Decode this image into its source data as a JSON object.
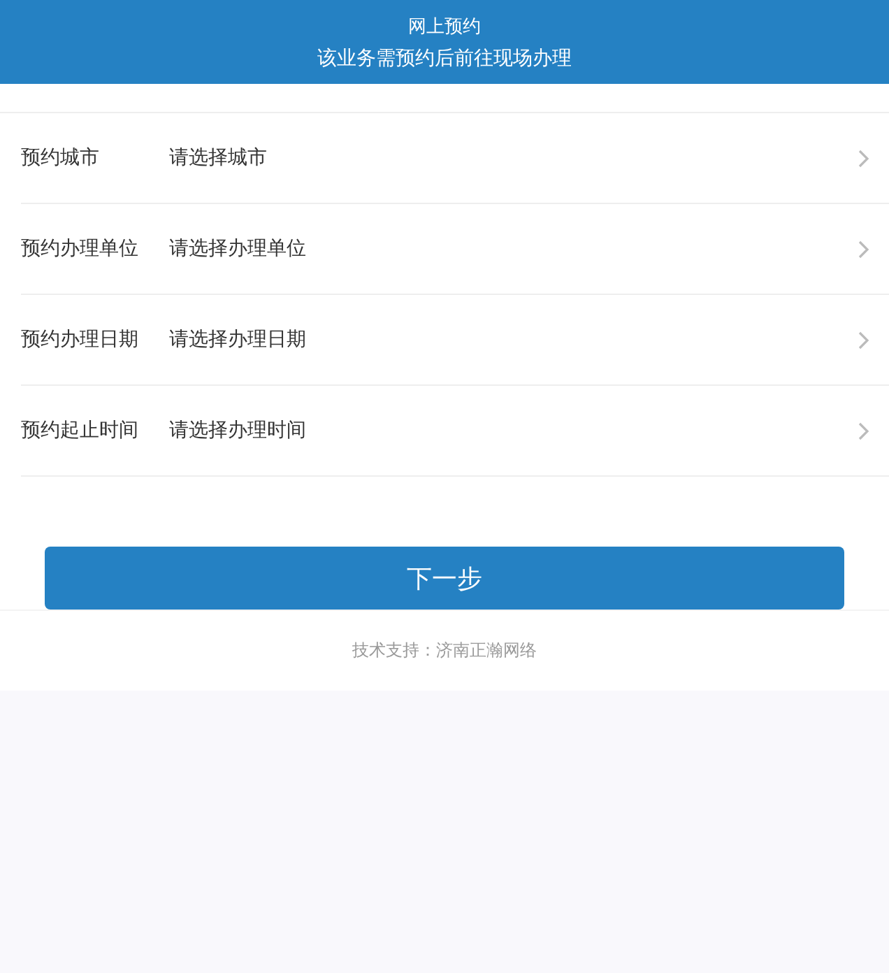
{
  "header": {
    "title": "网上预约",
    "subtitle": "该业务需预约后前往现场办理"
  },
  "form_rows": [
    {
      "label": "预约城市",
      "placeholder": "请选择城市"
    },
    {
      "label": "预约办理单位",
      "placeholder": "请选择办理单位"
    },
    {
      "label": "预约办理日期",
      "placeholder": "请选择办理日期"
    },
    {
      "label": "预约起止时间",
      "placeholder": "请选择办理时间"
    }
  ],
  "next_button": "下一步",
  "footer": "技术支持：济南正瀚网络"
}
